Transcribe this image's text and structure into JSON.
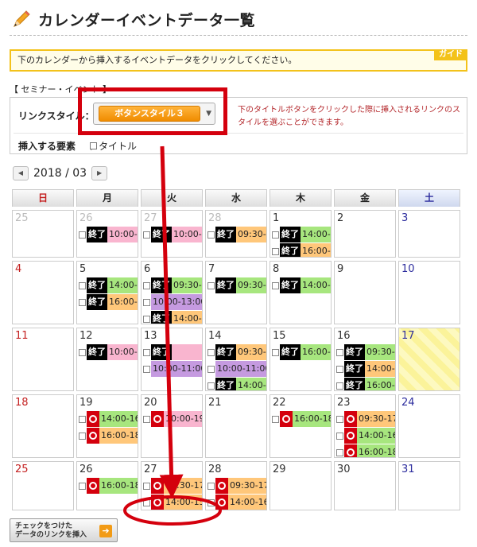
{
  "page": {
    "title": "カレンダーイベントデータ一覧",
    "guide_text": "下のカレンダーから挿入するイベントデータをクリックしてください。",
    "guide_tag": "ガイド"
  },
  "settings": {
    "section_label": "【 セミナー・イベント 】",
    "link_style_label": "リンクスタイル：",
    "selected_style": "ボタンスタイル３",
    "help_text": "下のタイトルボタンをクリックした際に挿入されるリンクのスタイルを選ぶことができます。",
    "insert_label": "挿入する要素",
    "insert_colon": "：",
    "insert_option": "タイトル"
  },
  "nav": {
    "month": "2018 / 03",
    "prev_icon": "◀",
    "next_icon": "▶"
  },
  "weekdays": [
    "日",
    "月",
    "火",
    "水",
    "木",
    "金",
    "土"
  ],
  "weeks": [
    {
      "height": 60,
      "days": [
        {
          "num": "25",
          "prev": true,
          "events": []
        },
        {
          "num": "26",
          "prev": true,
          "events": [
            {
              "status": "終了",
              "time": "10:00-",
              "color": "pink"
            }
          ]
        },
        {
          "num": "27",
          "prev": true,
          "events": [
            {
              "status": "終了",
              "time": "10:00-",
              "color": "pink"
            }
          ]
        },
        {
          "num": "28",
          "prev": true,
          "events": [
            {
              "status": "終了",
              "time": "09:30-",
              "color": "orange"
            }
          ]
        },
        {
          "num": "1",
          "events": [
            {
              "status": "終了",
              "time": "14:00-",
              "color": "green"
            },
            {
              "status": "終了",
              "time": "16:00-",
              "color": "orange"
            }
          ]
        },
        {
          "num": "2",
          "events": []
        },
        {
          "num": "3",
          "events": []
        }
      ]
    },
    {
      "height": 80,
      "days": [
        {
          "num": "4",
          "events": []
        },
        {
          "num": "5",
          "events": [
            {
              "status": "終了",
              "time": "14:00-",
              "color": "green"
            },
            {
              "status": "終了",
              "time": "16:00-",
              "color": "orange"
            }
          ]
        },
        {
          "num": "6",
          "events": [
            {
              "status": "終了",
              "time": "09:30-",
              "color": "green"
            },
            {
              "status": "",
              "time": "10:00-13:00",
              "color": "purple"
            },
            {
              "status": "終了",
              "time": "14:00-",
              "color": "orange"
            }
          ]
        },
        {
          "num": "7",
          "events": [
            {
              "status": "終了",
              "time": "09:30-",
              "color": "green"
            }
          ]
        },
        {
          "num": "8",
          "events": [
            {
              "status": "終了",
              "time": "14:00-",
              "color": "green"
            }
          ]
        },
        {
          "num": "9",
          "events": []
        },
        {
          "num": "10",
          "events": []
        }
      ]
    },
    {
      "height": 80,
      "days": [
        {
          "num": "11",
          "events": []
        },
        {
          "num": "12",
          "events": [
            {
              "status": "終了",
              "time": "10:00-",
              "color": "pink"
            }
          ]
        },
        {
          "num": "13",
          "events": [
            {
              "status": "終了",
              "time": "",
              "color": "pink"
            },
            {
              "status": "",
              "time": "10:00-11:00",
              "color": "purple"
            }
          ]
        },
        {
          "num": "14",
          "events": [
            {
              "status": "終了",
              "time": "09:30-",
              "color": "orange"
            },
            {
              "status": "",
              "time": "10:00-11:00",
              "color": "purple"
            },
            {
              "status": "終了",
              "time": "14:00-",
              "color": "green"
            }
          ]
        },
        {
          "num": "15",
          "events": [
            {
              "status": "終了",
              "time": "16:00-",
              "color": "green"
            }
          ]
        },
        {
          "num": "16",
          "events": [
            {
              "status": "終了",
              "time": "09:30-",
              "color": "green"
            },
            {
              "status": "終了",
              "time": "14:00-",
              "color": "orange"
            },
            {
              "status": "終了",
              "time": "16:00-",
              "color": "green"
            }
          ]
        },
        {
          "num": "17",
          "today": true,
          "events": []
        }
      ]
    },
    {
      "height": 80,
      "days": [
        {
          "num": "18",
          "events": []
        },
        {
          "num": "19",
          "events": [
            {
              "status": "open",
              "time": "14:00-16",
              "color": "green"
            },
            {
              "status": "open",
              "time": "16:00-18",
              "color": "orange"
            }
          ]
        },
        {
          "num": "20",
          "events": [
            {
              "status": "open",
              "time": "10:00-19",
              "color": "pink"
            }
          ]
        },
        {
          "num": "21",
          "events": []
        },
        {
          "num": "22",
          "events": [
            {
              "status": "open",
              "time": "16:00-18",
              "color": "green"
            }
          ]
        },
        {
          "num": "23",
          "events": [
            {
              "status": "open",
              "time": "09:30-17",
              "color": "orange"
            },
            {
              "status": "open",
              "time": "14:00-16",
              "color": "green"
            },
            {
              "status": "open",
              "time": "16:00-18",
              "color": "green"
            }
          ]
        },
        {
          "num": "24",
          "events": []
        }
      ]
    },
    {
      "height": 62,
      "days": [
        {
          "num": "25",
          "events": []
        },
        {
          "num": "26",
          "events": [
            {
              "status": "open",
              "time": "16:00-18",
              "color": "green"
            }
          ]
        },
        {
          "num": "27",
          "events": [
            {
              "status": "open",
              "time": "09:30-17",
              "color": "orange"
            },
            {
              "status": "open",
              "time": "14:00-15",
              "color": "orange"
            }
          ]
        },
        {
          "num": "28",
          "events": [
            {
              "status": "open",
              "time": "09:30-17",
              "color": "orange"
            },
            {
              "status": "open",
              "time": "14:00-16",
              "color": "orange"
            }
          ]
        },
        {
          "num": "29",
          "events": []
        },
        {
          "num": "30",
          "events": []
        },
        {
          "num": "31",
          "events": []
        }
      ]
    }
  ],
  "insert_button": {
    "line1": "チェックをつけた",
    "line2": "データのリンクを挿入",
    "icon": "➔"
  },
  "icons": {
    "title": "pencil-icon",
    "select": "chevron-down-icon",
    "insert": "arrow-into-box-icon"
  },
  "colors": {
    "highlight": "#d4000d",
    "guide_border": "#f3c21a",
    "button_orange": "#f08c00"
  }
}
